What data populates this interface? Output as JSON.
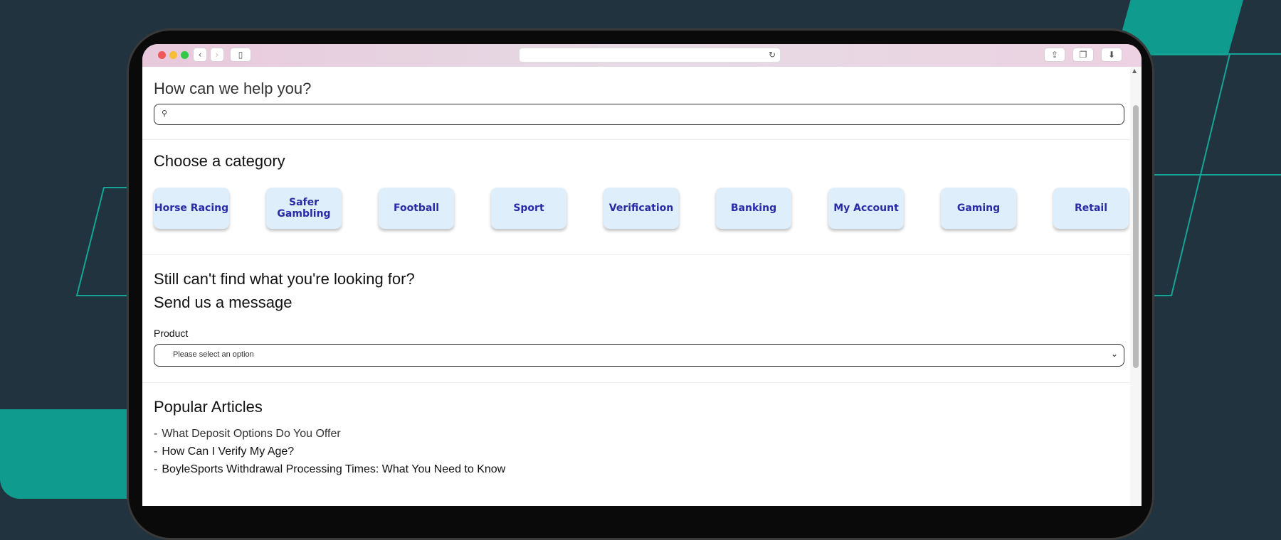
{
  "colors": {
    "background": "#21333f",
    "teal_accent": "#0f9b8e",
    "category_bg": "#deeefa",
    "category_text": "#2a2aa8"
  },
  "browser": {
    "traffic_lights": [
      "#f0595a",
      "#f5be36",
      "#34c84a"
    ],
    "icons": {
      "back": "chevron-left-icon",
      "forward": "chevron-right-icon",
      "sidebar": "sidebar-icon",
      "reload": "reload-icon",
      "share": "share-icon",
      "tabs": "tabs-icon",
      "download": "download-icon"
    }
  },
  "help": {
    "title": "How can we help you?",
    "search_icon": "search-icon"
  },
  "categories": {
    "title": "Choose a category",
    "items": [
      {
        "label": "Horse Racing"
      },
      {
        "label": "Safer Gambling"
      },
      {
        "label": "Football"
      },
      {
        "label": "Sport"
      },
      {
        "label": "Verification"
      },
      {
        "label": "Banking"
      },
      {
        "label": "My Account"
      },
      {
        "label": "Gaming"
      },
      {
        "label": "Retail"
      }
    ]
  },
  "contact": {
    "still_title": "Still can't find what you're looking for?",
    "send_title": "Send us a message",
    "product_label": "Product",
    "select_value": "Please select an option"
  },
  "popular": {
    "title": "Popular Articles",
    "dash": "-",
    "articles": [
      {
        "title": "What Deposit Options Do You Offer"
      },
      {
        "title": "How Can I Verify My Age?"
      },
      {
        "title": "BoyleSports Withdrawal Processing Times: What You Need to Know"
      }
    ]
  }
}
